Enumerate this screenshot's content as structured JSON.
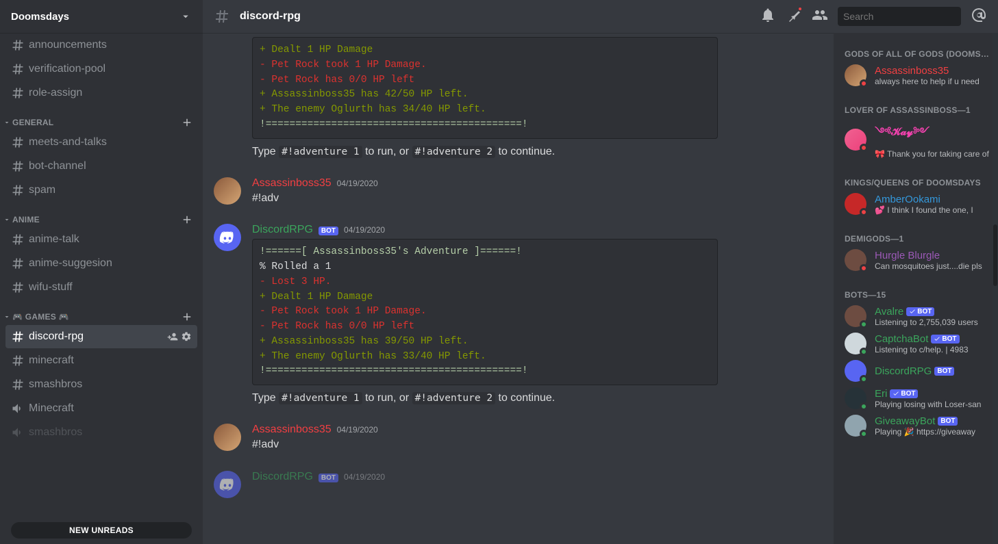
{
  "guild": {
    "name": "Doomsdays"
  },
  "unread_pill": "NEW UNREADS",
  "topChannels": [
    {
      "name": "announcements"
    },
    {
      "name": "verification-pool"
    },
    {
      "name": "role-assign"
    }
  ],
  "categories": [
    {
      "name": "GENERAL",
      "channels": [
        {
          "name": "meets-and-talks"
        },
        {
          "name": "bot-channel"
        },
        {
          "name": "spam"
        }
      ]
    },
    {
      "name": "ANIME",
      "channels": [
        {
          "name": "anime-talk"
        },
        {
          "name": "anime-suggesion"
        },
        {
          "name": "wifu-stuff"
        }
      ]
    },
    {
      "name": "🎮 GAMES 🎮",
      "channels": [
        {
          "name": "discord-rpg",
          "active": true
        },
        {
          "name": "minecraft"
        },
        {
          "name": "smashbros"
        },
        {
          "name": "Minecraft",
          "voice": true
        },
        {
          "name": "smashbros",
          "voice": true,
          "dim": true
        }
      ]
    }
  ],
  "currentChannel": "discord-rpg",
  "search": {
    "placeholder": "Search"
  },
  "messages": {
    "prefixText": "Type ",
    "midText": " to run, or ",
    "suffixText": " to continue.",
    "adv1": "#!adventure 1",
    "adv2": "#!adventure 2",
    "cb0": [
      {
        "cls": "cb-g",
        "t": "+ Dealt 1 HP Damage"
      },
      {
        "cls": "cb-r",
        "t": "- Pet Rock took 1 HP Damage."
      },
      {
        "cls": "cb-r",
        "t": "- Pet Rock has 0/0 HP left"
      },
      {
        "cls": "cb-g",
        "t": "+ Assassinboss35 has 42/50 HP left."
      },
      {
        "cls": "cb-g",
        "t": "+ The enemy Oglurth has 34/40 HP left."
      },
      {
        "cls": "cb-y",
        "t": "!===========================================!"
      }
    ],
    "m1": {
      "author": "Assassinboss35",
      "ts": "04/19/2020",
      "text": "#!adv"
    },
    "m2": {
      "author": "DiscordRPG",
      "ts": "04/19/2020",
      "cb": [
        {
          "cls": "cb-y",
          "t": "!======[ Assassinboss35's Adventure ]======!"
        },
        {
          "cls": "cb-w",
          "t": "% Rolled a 1"
        },
        {
          "cls": "cb-r",
          "t": "- Lost 3 HP."
        },
        {
          "cls": "cb-g",
          "t": "+ Dealt 1 HP Damage"
        },
        {
          "cls": "cb-r",
          "t": "- Pet Rock took 1 HP Damage."
        },
        {
          "cls": "cb-r",
          "t": "- Pet Rock has 0/0 HP left"
        },
        {
          "cls": "cb-g",
          "t": "+ Assassinboss35 has 39/50 HP left."
        },
        {
          "cls": "cb-g",
          "t": "+ The enemy Oglurth has 33/40 HP left."
        },
        {
          "cls": "cb-y",
          "t": "!===========================================!"
        }
      ]
    },
    "m3": {
      "author": "Assassinboss35",
      "ts": "04/19/2020",
      "text": "#!adv"
    },
    "m4": {
      "author": "DiscordRPG",
      "ts": "04/19/2020"
    }
  },
  "memberGroups": [
    {
      "title": "GODS OF ALL OF GODS (DOOMSDAYS)",
      "members": [
        {
          "name": "Assassinboss35",
          "cls": "name-red",
          "sub": "always here to help if u need",
          "status": "dnd",
          "avc": "m-avatar-anime"
        }
      ]
    },
    {
      "title": "LOVER OF ASSASSINBOSS—1",
      "members": [
        {
          "name": "༺𝓚𝓪𝔂༻",
          "cls": "name-pink",
          "sub": "🎀 Thank you for taking care of",
          "status": "dnd",
          "avc": "m-avatar-pink"
        }
      ]
    },
    {
      "title": "KINGS/QUEENS OF DOOMSDAYS",
      "members": [
        {
          "name": "AmberOokami",
          "cls": "name-blue",
          "sub": "💕 I think I found the one, I",
          "status": "dnd",
          "avc": "m-avatar-red"
        }
      ]
    },
    {
      "title": "DEMIGODS—1",
      "members": [
        {
          "name": "Hurgle Blurgle",
          "cls": "name-purple",
          "sub": "Can mosquitoes just....die pls",
          "status": "dnd",
          "avc": "m-avatar-brown"
        }
      ]
    },
    {
      "title": "BOTS—15",
      "members": [
        {
          "name": "Avalre",
          "cls": "name-green",
          "sub": "Listening to 2,755,039 users",
          "status": "online",
          "bot": true,
          "check": true,
          "avc": "m-avatar-brown"
        },
        {
          "name": "CaptchaBot",
          "cls": "name-green",
          "sub": "Listening to c/help. | 4983",
          "status": "online",
          "bot": true,
          "check": true,
          "avc": "m-avatar-white"
        },
        {
          "name": "DiscordRPG",
          "cls": "name-green",
          "sub": "",
          "status": "online",
          "bot": true,
          "avc": "m-avatar-blurple"
        },
        {
          "name": "Eri",
          "cls": "name-green",
          "sub": "Playing losing with Loser-san",
          "status": "online",
          "bot": true,
          "check": true,
          "avc": "m-avatar-dark"
        },
        {
          "name": "GiveawayBot",
          "cls": "name-green",
          "sub": "Playing 🎉 https://giveaway",
          "status": "online",
          "bot": true,
          "avc": "m-avatar-conf"
        }
      ]
    }
  ]
}
